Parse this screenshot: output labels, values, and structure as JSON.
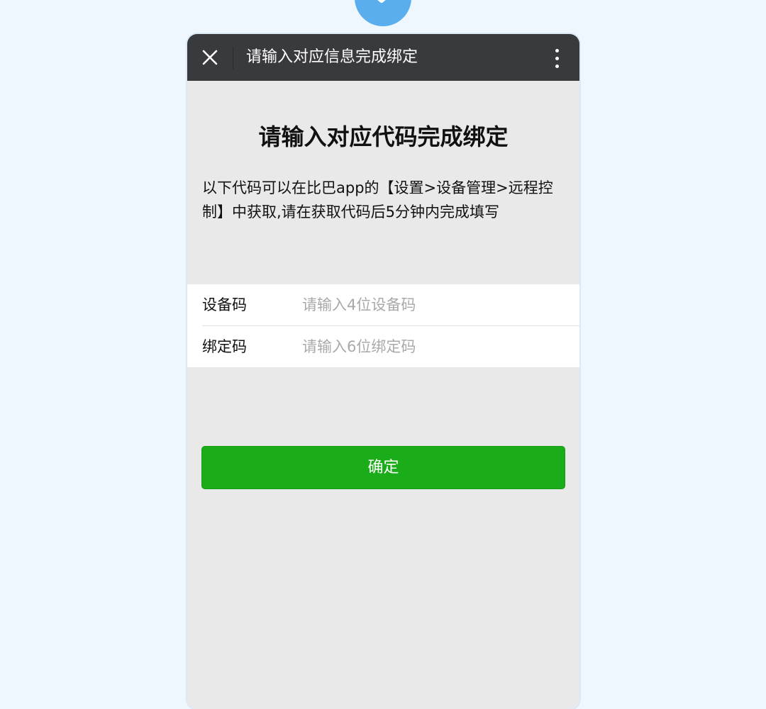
{
  "header": {
    "title": "请输入对应信息完成绑定",
    "close_icon": "close-icon",
    "more_icon": "more-vertical-icon"
  },
  "main": {
    "heading": "请输入对应代码完成绑定",
    "description": "以下代码可以在比巴app的【设置>设备管理>远程控制】中获取,请在获取代码后5分钟内完成填写"
  },
  "form": {
    "fields": [
      {
        "label": "设备码",
        "placeholder": "请输入4位设备码",
        "value": ""
      },
      {
        "label": "绑定码",
        "placeholder": "请输入6位绑定码",
        "value": ""
      }
    ]
  },
  "actions": {
    "confirm_label": "确定"
  },
  "colors": {
    "page_background": "#eef6fe",
    "titlebar": "#393a3e",
    "content_background": "#e9e9e9",
    "primary_button": "#1aad19",
    "badge": "#5aaeee",
    "placeholder_text": "#a9a9a9"
  }
}
